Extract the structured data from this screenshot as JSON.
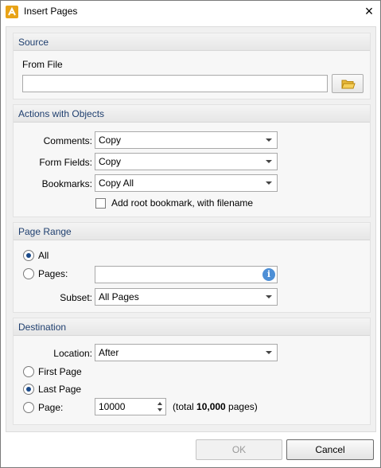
{
  "window": {
    "title": "Insert Pages",
    "app_icon": "pdf-app-icon",
    "close_glyph": "×"
  },
  "source": {
    "header": "Source",
    "from_file_label": "From File",
    "from_file_value": "",
    "browse_icon": "folder-icon"
  },
  "actions": {
    "header": "Actions with Objects",
    "comments_label": "Comments:",
    "comments_value": "Copy",
    "form_fields_label": "Form Fields:",
    "form_fields_value": "Copy",
    "bookmarks_label": "Bookmarks:",
    "bookmarks_value": "Copy All",
    "add_root_bookmark_label": "Add root bookmark, with filename",
    "add_root_bookmark_checked": false
  },
  "page_range": {
    "header": "Page Range",
    "all_label": "All",
    "all_checked": true,
    "pages_label": "Pages:",
    "pages_value": "",
    "info_icon": "info-icon",
    "subset_label": "Subset:",
    "subset_value": "All Pages"
  },
  "destination": {
    "header": "Destination",
    "location_label": "Location:",
    "location_value": "After",
    "first_page_label": "First Page",
    "last_page_label": "Last Page",
    "last_page_checked": true,
    "page_label": "Page:",
    "page_value": "10000",
    "total_prefix": "(total ",
    "total_count": "10,000",
    "total_suffix": " pages)"
  },
  "buttons": {
    "ok_label": "OK",
    "cancel_label": "Cancel"
  }
}
